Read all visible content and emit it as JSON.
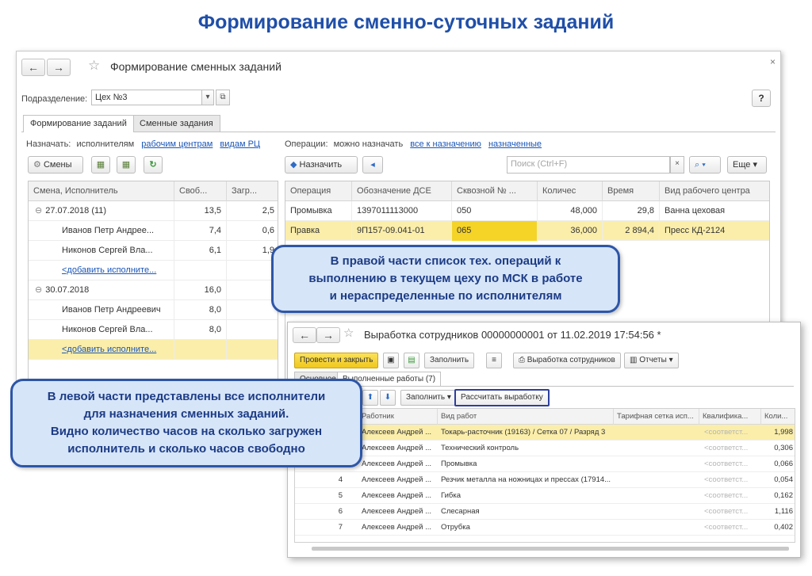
{
  "slide_title": "Формирование сменно-суточных заданий",
  "window1": {
    "title": "Формирование сменных заданий",
    "back": "←",
    "forward": "→",
    "close": "×",
    "help": "?",
    "division_label": "Подразделение:",
    "division_value": "Цех №3",
    "tabs": [
      "Формирование заданий",
      "Сменные задания"
    ],
    "left": {
      "assign_label": "Назначать:",
      "assign_value": "исполнителям",
      "link_centers": "рабочим центрам",
      "link_types": "видам РЦ",
      "shifts_button": "Смены",
      "columns": [
        "Смена, Исполнитель",
        "Своб...",
        "Загр..."
      ],
      "rows": [
        {
          "name": "27.07.2018 (11)",
          "free": "13,5",
          "load": "2,5",
          "group": true
        },
        {
          "name": "Иванов Петр Андрее...",
          "free": "7,4",
          "load": "0,6"
        },
        {
          "name": "Никонов Сергей Вла...",
          "free": "6,1",
          "load": "1,9"
        },
        {
          "name": "<добавить исполните...",
          "free": "",
          "load": "",
          "link": true
        },
        {
          "name": "30.07.2018",
          "free": "16,0",
          "load": "",
          "group": true
        },
        {
          "name": "Иванов Петр Андреевич",
          "free": "8,0",
          "load": ""
        },
        {
          "name": "Никонов Сергей Вла...",
          "free": "8,0",
          "load": ""
        },
        {
          "name": "<добавить исполните...",
          "free": "",
          "load": "",
          "link": true,
          "selected": true
        }
      ]
    },
    "right": {
      "ops_label": "Операции:",
      "ops_value": "можно назначать",
      "link_all": "все к назначению",
      "link_assigned": "назначенные",
      "assign_button": "Назначить",
      "search_placeholder": "Поиск (Ctrl+F)",
      "search_clear": "×",
      "more_button": "Еще",
      "columns": [
        "Операция",
        "Обозначение ДСЕ",
        "Сквозной № ...",
        "Количес",
        "Время",
        "Вид рабочего центра"
      ],
      "rows": [
        {
          "op": "Промывка",
          "dse": "1397011113000",
          "num": "050",
          "qty": "48,000",
          "time": "29,8",
          "wc": "Ванна цеховая"
        },
        {
          "op": "Правка",
          "dse": "9П157-09.041-01",
          "num": "065",
          "qty": "36,000",
          "time": "2 894,4",
          "wc": "Пресс КД-2124",
          "selected": true
        }
      ]
    }
  },
  "window2": {
    "title": "Выработка сотрудников 00000000001 от 11.02.2019 17:54:56 *",
    "post_close": "Провести и закрыть",
    "fill": "Заполнить",
    "output_button": "Выработка сотрудников",
    "reports": "Отчеты",
    "tab_label": "Выполненные работы (7)",
    "tab_prev": "Основное",
    "fill2": "Заполнить",
    "calc": "Рассчитать выработку",
    "columns": [
      "Работник",
      "Вид работ",
      "Тарифная сетка исп...",
      "Квалифика...",
      "Коли..."
    ],
    "placeholder_soot": "<соответст...",
    "rows": [
      {
        "n": "",
        "worker": "Алексеев Андрей ...",
        "work": "Токарь-расточник (19163) / Сетка 07 / Разряд 3",
        "qty": "1,998",
        "selected": true
      },
      {
        "n": "",
        "worker": "Алексеев Андрей ...",
        "work": "Технический контроль",
        "qty": "0,306"
      },
      {
        "n": "",
        "worker": "Алексеев Андрей ...",
        "work": "Промывка",
        "qty": "0,066"
      },
      {
        "n": "4",
        "worker": "Алексеев Андрей ...",
        "work": "Резчик металла на ножницах и прессах (17914...",
        "qty": "0,054"
      },
      {
        "n": "5",
        "worker": "Алексеев Андрей ...",
        "work": "Гибка",
        "qty": "0,162"
      },
      {
        "n": "6",
        "worker": "Алексеев Андрей ...",
        "work": "Слесарная",
        "qty": "1,116"
      },
      {
        "n": "7",
        "worker": "Алексеев Андрей ...",
        "work": "Отрубка",
        "qty": "0,402"
      }
    ]
  },
  "callout_right": "В правой части список тех. операций к\nвыполнению в текущем цеху по МСК в работе\nи нераспределенные по исполнителям",
  "callout_left": "В левой части представлены все исполнители\nдля назначения сменных заданий.\nВидно количество часов на сколько загружен\nисполнитель и сколько часов свободно",
  "colors": {
    "title": "#1f4fa8",
    "highlight": "#f5d327",
    "selected_row": "#fbeeaa",
    "callout_border": "#2d56a8",
    "callout_bg": "#d6e5f8"
  }
}
